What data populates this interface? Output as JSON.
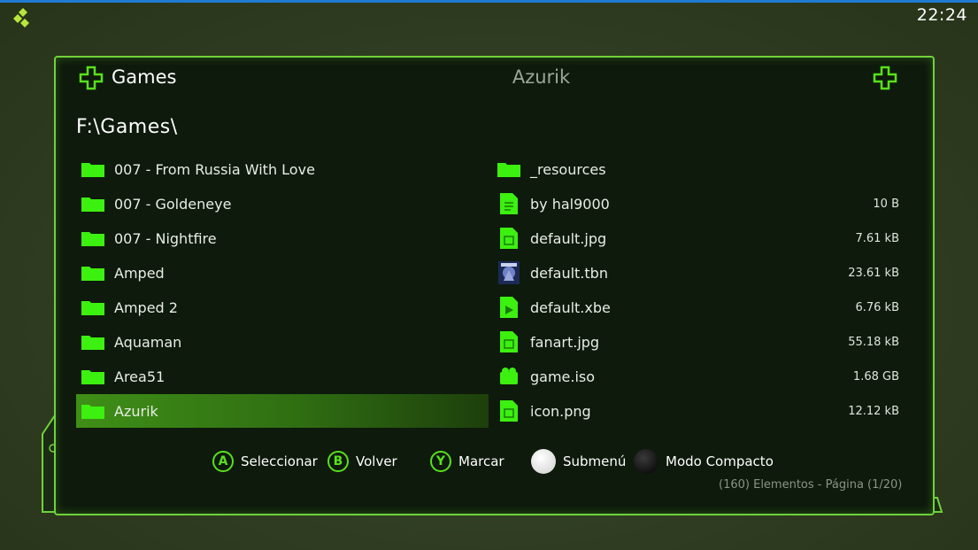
{
  "clock": "22:24",
  "header": {
    "title": "Games",
    "current_item": "Azurik",
    "path": "F:\\Games\\"
  },
  "folders": [
    {
      "label": "007 - From Russia With Love"
    },
    {
      "label": "007 - Goldeneye"
    },
    {
      "label": "007 - Nightfire"
    },
    {
      "label": "Amped"
    },
    {
      "label": "Amped 2"
    },
    {
      "label": "Aquaman"
    },
    {
      "label": "Area51"
    },
    {
      "label": "Azurik",
      "selected": true
    }
  ],
  "files": [
    {
      "label": "_resources",
      "size": "",
      "icon": "folder-icon"
    },
    {
      "label": "by hal9000",
      "size": "10  B",
      "icon": "text-file-icon"
    },
    {
      "label": "default.jpg",
      "size": "7.61 kB",
      "icon": "image-file-icon"
    },
    {
      "label": "default.tbn",
      "size": "23.61 kB",
      "icon": "thumbnail-icon"
    },
    {
      "label": "default.xbe",
      "size": "6.76 kB",
      "icon": "executable-file-icon"
    },
    {
      "label": "fanart.jpg",
      "size": "55.18 kB",
      "icon": "image-file-icon"
    },
    {
      "label": "game.iso",
      "size": "1.68 GB",
      "icon": "disc-image-icon"
    },
    {
      "label": "icon.png",
      "size": "12.12 kB",
      "icon": "image-file-icon"
    }
  ],
  "hints": {
    "a_key": "A",
    "a_label": "Seleccionar",
    "b_key": "B",
    "b_label": "Volver",
    "y_key": "Y",
    "y_label": "Marcar",
    "white_label": "Submenú",
    "black_label": "Modo Compacto"
  },
  "status": {
    "count": "(160)",
    "items_word": "Elementos - Página",
    "page": "(1/20)"
  },
  "colors": {
    "accent": "#59e01c",
    "panel_border": "#6fd23a",
    "selection": "#3f8f17"
  }
}
